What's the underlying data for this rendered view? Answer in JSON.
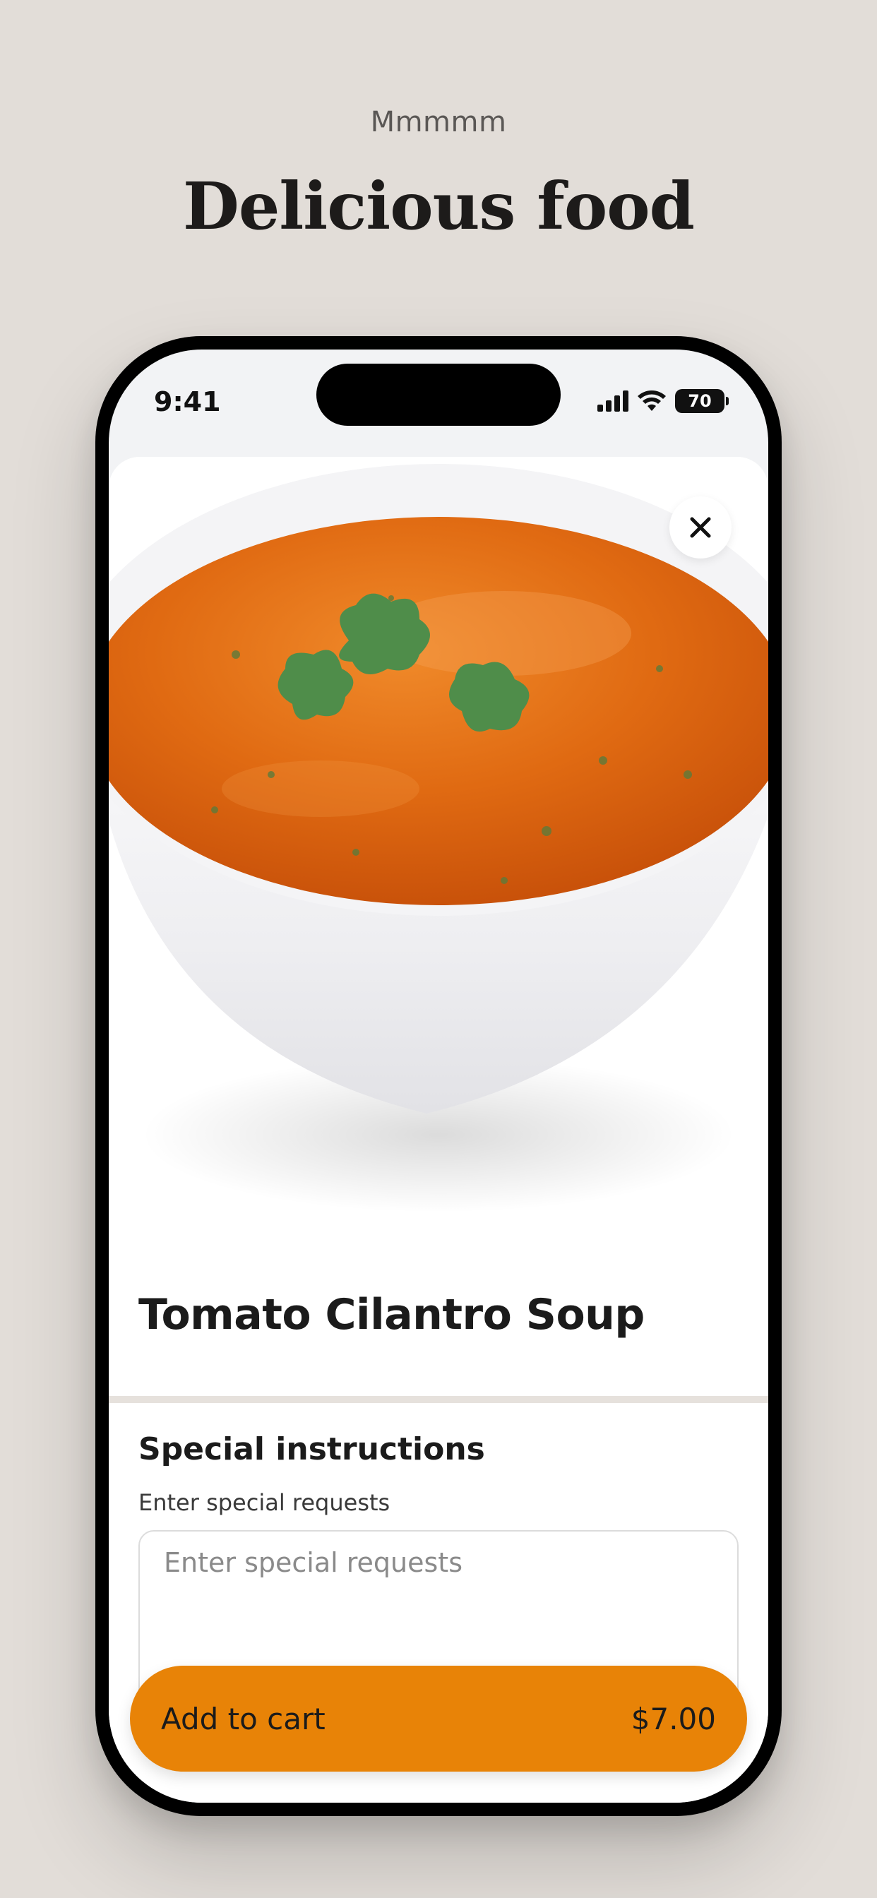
{
  "header": {
    "eyebrow": "Mmmmm",
    "headline": "Delicious food"
  },
  "status_bar": {
    "time": "9:41",
    "battery": "70",
    "icons": [
      "cellular-signal-icon",
      "wifi-icon",
      "battery-icon"
    ]
  },
  "item": {
    "image": "tomato-soup-bowl-image",
    "title": "Tomato Cilantro Soup"
  },
  "special_instructions": {
    "title": "Special instructions",
    "subtitle": "Enter special requests",
    "placeholder": "Enter special requests",
    "value": ""
  },
  "cart": {
    "label": "Add to cart",
    "price": "$7.00"
  },
  "colors": {
    "background": "#e2ddd8",
    "accent": "#e88307",
    "soup": "#e06a12",
    "cilantro": "#4f8d4a"
  }
}
